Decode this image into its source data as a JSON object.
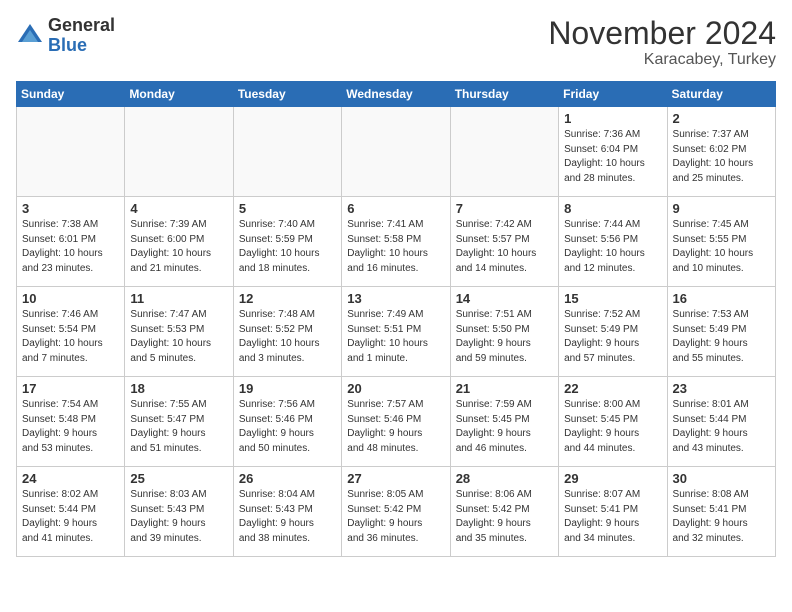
{
  "header": {
    "logo_general": "General",
    "logo_blue": "Blue",
    "month_title": "November 2024",
    "location": "Karacabey, Turkey"
  },
  "days_of_week": [
    "Sunday",
    "Monday",
    "Tuesday",
    "Wednesday",
    "Thursday",
    "Friday",
    "Saturday"
  ],
  "weeks": [
    [
      {
        "day": "",
        "info": ""
      },
      {
        "day": "",
        "info": ""
      },
      {
        "day": "",
        "info": ""
      },
      {
        "day": "",
        "info": ""
      },
      {
        "day": "",
        "info": ""
      },
      {
        "day": "1",
        "info": "Sunrise: 7:36 AM\nSunset: 6:04 PM\nDaylight: 10 hours\nand 28 minutes."
      },
      {
        "day": "2",
        "info": "Sunrise: 7:37 AM\nSunset: 6:02 PM\nDaylight: 10 hours\nand 25 minutes."
      }
    ],
    [
      {
        "day": "3",
        "info": "Sunrise: 7:38 AM\nSunset: 6:01 PM\nDaylight: 10 hours\nand 23 minutes."
      },
      {
        "day": "4",
        "info": "Sunrise: 7:39 AM\nSunset: 6:00 PM\nDaylight: 10 hours\nand 21 minutes."
      },
      {
        "day": "5",
        "info": "Sunrise: 7:40 AM\nSunset: 5:59 PM\nDaylight: 10 hours\nand 18 minutes."
      },
      {
        "day": "6",
        "info": "Sunrise: 7:41 AM\nSunset: 5:58 PM\nDaylight: 10 hours\nand 16 minutes."
      },
      {
        "day": "7",
        "info": "Sunrise: 7:42 AM\nSunset: 5:57 PM\nDaylight: 10 hours\nand 14 minutes."
      },
      {
        "day": "8",
        "info": "Sunrise: 7:44 AM\nSunset: 5:56 PM\nDaylight: 10 hours\nand 12 minutes."
      },
      {
        "day": "9",
        "info": "Sunrise: 7:45 AM\nSunset: 5:55 PM\nDaylight: 10 hours\nand 10 minutes."
      }
    ],
    [
      {
        "day": "10",
        "info": "Sunrise: 7:46 AM\nSunset: 5:54 PM\nDaylight: 10 hours\nand 7 minutes."
      },
      {
        "day": "11",
        "info": "Sunrise: 7:47 AM\nSunset: 5:53 PM\nDaylight: 10 hours\nand 5 minutes."
      },
      {
        "day": "12",
        "info": "Sunrise: 7:48 AM\nSunset: 5:52 PM\nDaylight: 10 hours\nand 3 minutes."
      },
      {
        "day": "13",
        "info": "Sunrise: 7:49 AM\nSunset: 5:51 PM\nDaylight: 10 hours\nand 1 minute."
      },
      {
        "day": "14",
        "info": "Sunrise: 7:51 AM\nSunset: 5:50 PM\nDaylight: 9 hours\nand 59 minutes."
      },
      {
        "day": "15",
        "info": "Sunrise: 7:52 AM\nSunset: 5:49 PM\nDaylight: 9 hours\nand 57 minutes."
      },
      {
        "day": "16",
        "info": "Sunrise: 7:53 AM\nSunset: 5:49 PM\nDaylight: 9 hours\nand 55 minutes."
      }
    ],
    [
      {
        "day": "17",
        "info": "Sunrise: 7:54 AM\nSunset: 5:48 PM\nDaylight: 9 hours\nand 53 minutes."
      },
      {
        "day": "18",
        "info": "Sunrise: 7:55 AM\nSunset: 5:47 PM\nDaylight: 9 hours\nand 51 minutes."
      },
      {
        "day": "19",
        "info": "Sunrise: 7:56 AM\nSunset: 5:46 PM\nDaylight: 9 hours\nand 50 minutes."
      },
      {
        "day": "20",
        "info": "Sunrise: 7:57 AM\nSunset: 5:46 PM\nDaylight: 9 hours\nand 48 minutes."
      },
      {
        "day": "21",
        "info": "Sunrise: 7:59 AM\nSunset: 5:45 PM\nDaylight: 9 hours\nand 46 minutes."
      },
      {
        "day": "22",
        "info": "Sunrise: 8:00 AM\nSunset: 5:45 PM\nDaylight: 9 hours\nand 44 minutes."
      },
      {
        "day": "23",
        "info": "Sunrise: 8:01 AM\nSunset: 5:44 PM\nDaylight: 9 hours\nand 43 minutes."
      }
    ],
    [
      {
        "day": "24",
        "info": "Sunrise: 8:02 AM\nSunset: 5:44 PM\nDaylight: 9 hours\nand 41 minutes."
      },
      {
        "day": "25",
        "info": "Sunrise: 8:03 AM\nSunset: 5:43 PM\nDaylight: 9 hours\nand 39 minutes."
      },
      {
        "day": "26",
        "info": "Sunrise: 8:04 AM\nSunset: 5:43 PM\nDaylight: 9 hours\nand 38 minutes."
      },
      {
        "day": "27",
        "info": "Sunrise: 8:05 AM\nSunset: 5:42 PM\nDaylight: 9 hours\nand 36 minutes."
      },
      {
        "day": "28",
        "info": "Sunrise: 8:06 AM\nSunset: 5:42 PM\nDaylight: 9 hours\nand 35 minutes."
      },
      {
        "day": "29",
        "info": "Sunrise: 8:07 AM\nSunset: 5:41 PM\nDaylight: 9 hours\nand 34 minutes."
      },
      {
        "day": "30",
        "info": "Sunrise: 8:08 AM\nSunset: 5:41 PM\nDaylight: 9 hours\nand 32 minutes."
      }
    ]
  ]
}
